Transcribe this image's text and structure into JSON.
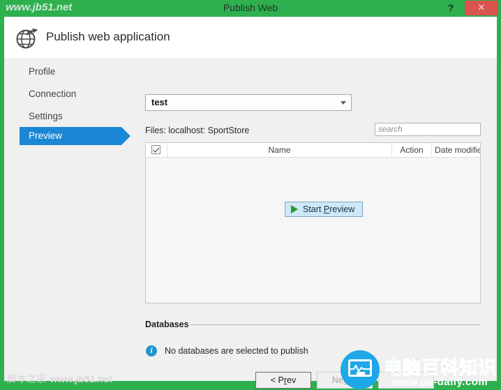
{
  "titlebar": {
    "watermark": "www.jb51.net",
    "title": "Publish Web",
    "help_label": "?",
    "close_label": "✕"
  },
  "header": {
    "icon": "globe-publish-icon",
    "title": "Publish web application"
  },
  "sidebar": {
    "items": [
      {
        "label": "Profile",
        "selected": false
      },
      {
        "label": "Connection",
        "selected": false
      },
      {
        "label": "Settings",
        "selected": false
      },
      {
        "label": "Preview",
        "selected": true
      }
    ]
  },
  "main": {
    "profile_select": {
      "value": "test",
      "caret_icon": "chevron-down-icon"
    },
    "files_label": "Files:  localhost: SportStore",
    "search": {
      "value": "",
      "placeholder": "search"
    },
    "filelist": {
      "columns": [
        {
          "key": "check",
          "label": ""
        },
        {
          "key": "name",
          "label": "Name"
        },
        {
          "key": "action",
          "label": "Action"
        },
        {
          "key": "date",
          "label": "Date modifie"
        }
      ],
      "select_all_checked": true,
      "rows": [],
      "start_preview": {
        "label_pre": "Start ",
        "label_accel": "P",
        "label_post": "review",
        "icon": "play-icon"
      }
    },
    "databases": {
      "title": "Databases",
      "info_icon": "info-icon",
      "message": "No databases are selected to publish"
    }
  },
  "footer": {
    "prev": {
      "pre": "< P",
      "accel": "r",
      "post": "ev",
      "enabled": true
    },
    "next": {
      "pre": "Ne",
      "accel": "x",
      "post": "t >",
      "enabled": false
    },
    "extra": {
      "label": "",
      "enabled": false
    }
  },
  "watermarks": {
    "bottom_left_cn": "脚本之家",
    "bottom_left_url": "www.jb51.net",
    "badge_cn": "电脑百科知识",
    "badge_url": "www.pc-daily.com"
  },
  "colors": {
    "window_green": "#2eb04f",
    "accent_blue": "#1c87d4",
    "close_red": "#d9534f",
    "info_blue": "#2196cf",
    "play_green": "#2b9c2b",
    "badge_blue": "#1fa8e8"
  }
}
